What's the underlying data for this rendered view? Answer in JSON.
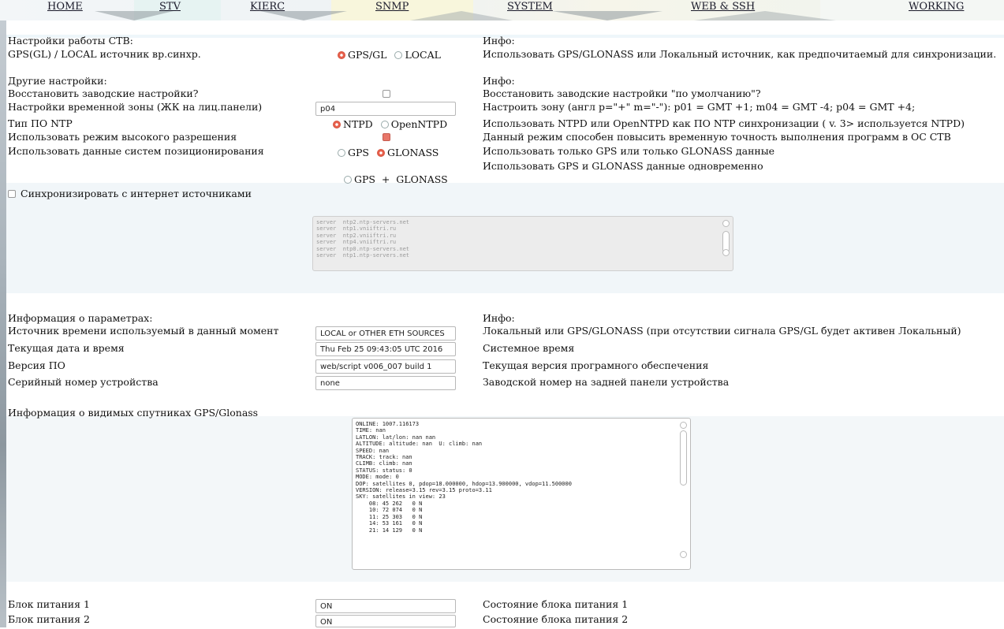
{
  "nav": {
    "items": [
      "HOME",
      "STV",
      "KIERC",
      "SNMP",
      "SYSTEM",
      "WEB & SSH",
      "WORKING"
    ]
  },
  "stv": {
    "heading": "Настройки работы СТВ:",
    "info_heading": "Инфо:",
    "sync_label": "GPS(GL) / LOCAL источник вр.синхр.",
    "opt_gps": "GPS/GL",
    "opt_local": "LOCAL",
    "sync_info": "Использовать GPS/GLONASS или Локальный источник, как предпочитаемый для синхронизации."
  },
  "other": {
    "heading": "Другие настройки:",
    "info_heading": "Инфо:",
    "reset_label": "Восстановить заводские настройки?",
    "reset_info": "Восстановить заводские настройки \"по умолчанию\"?",
    "tz_label": "Настройки временной зоны (ЖК на лиц.панели)",
    "tz_value": "p04",
    "tz_info": "Настроить зону (англ p=\"+\" m=\"-\"): p01 = GMT +1; m04 = GMT -4; p04 = GMT +4;",
    "ntp_label": "Тип ПО NTP",
    "ntp_opt1": "NTPD",
    "ntp_opt2": "OpenNTPD",
    "ntp_info": "Использовать NTPD или OpenNTPD как ПО NTP синхронизации ( v. 3> используется NTPD)",
    "hires_label": "Использовать режим высокого разрешения",
    "hires_info": "Данный режим способен повысить временную точность выполнения программ в ОС СТВ",
    "pos_label": "Использовать данные систем позиционирования",
    "pos_opt_gps": "GPS",
    "pos_opt_glonass": "GLONASS",
    "pos_info": "Использовать только GPS или только GLONASS данные",
    "pos_opt_both": "GPS  +  GLONASS",
    "pos_both_info": "Использовать GPS и GLONASS данные одновременно"
  },
  "internet": {
    "label": "Синхронизировать с интернет источниками",
    "servers": "server  ntp2.ntp-servers.net\nserver  ntp1.vniiftri.ru\nserver  ntp2.vniiftri.ru\nserver  ntp4.vniiftri.ru\nserver  ntp0.ntp-servers.net\nserver  ntp1.ntp-servers.net"
  },
  "params": {
    "heading": "Информация о параметрах:",
    "info_heading": "Инфо:",
    "src_label": "Источник времени используемый в данный момент",
    "src_value": "LOCAL or OTHER ETH SOURCES",
    "src_info": "Локальный или GPS/GLONASS (при отсутствии сигнала GPS/GL будет активен Локальный)",
    "dt_label": "Текущая дата и время",
    "dt_value": "Thu Feb 25 09:43:05 UTC 2016",
    "dt_info": "Системное время",
    "ver_label": "Версия ПО",
    "ver_value": "web/script v006_007 build 1",
    "ver_info": "Текущая версия програмного обеспечения",
    "serial_label": "Серийный номер устройства",
    "serial_value": "none",
    "serial_info": "Заводской номер на задней панели устройства"
  },
  "sats": {
    "heading": "Информация о видимых спутниках GPS/Glonass",
    "log": "ONLINE: 1007.116173\nTIME: nan\nLATLON: lat/lon: nan nan\nALTITUDE: altitude: nan  U: climb: nan\nSPEED: nan\nTRACK: track: nan\nCLIMB: climb: nan\nSTATUS: status: 0\nMODE: mode: 0\nDOP: satellites 0, pdop=18.000000, hdop=13.900000, vdop=11.500000\nVERSION: release=3.15 rev=3.15 proto=3.11\nSKY: satellites in view: 23\n    08: 45 262   0 N\n    10: 72 074   0 N\n    11: 25 303   0 N\n    14: 53 161   0 N\n    21: 14 129   0 N"
  },
  "power": {
    "p1_label": "Блок питания 1",
    "p1_value": "ON",
    "p1_info": "Состояние блока питания 1",
    "p2_label": "Блок питания 2",
    "p2_value": "ON",
    "p2_info": "Состояние блока питания 2"
  },
  "colors": {
    "accent_radio": "#e8604c",
    "band": "#eef6fa"
  }
}
